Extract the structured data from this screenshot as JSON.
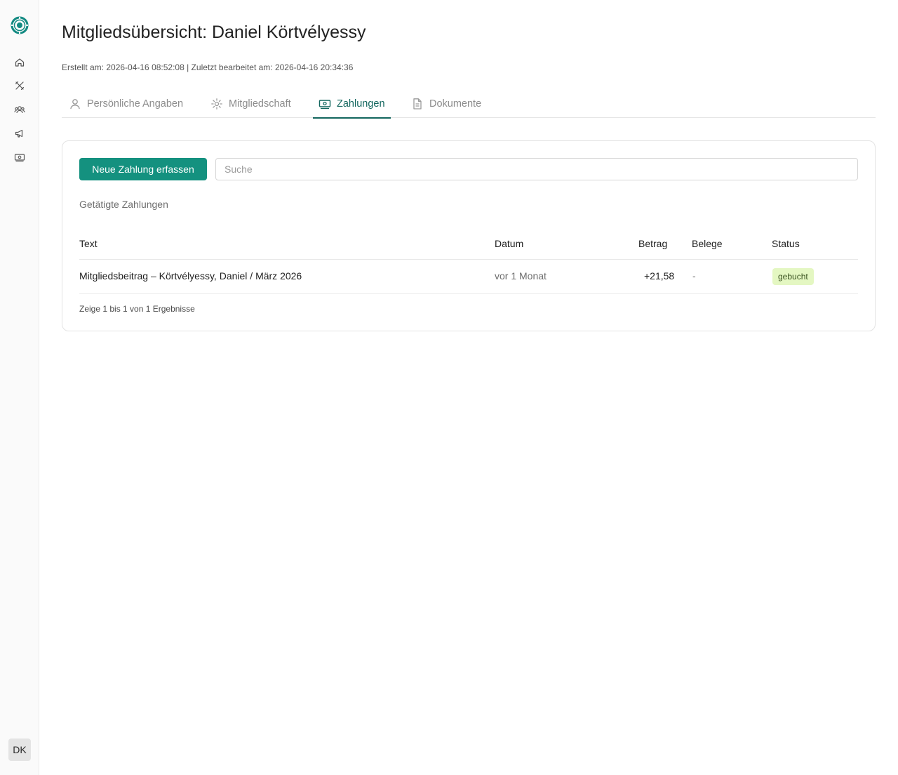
{
  "sidebar": {
    "logo": "club-logo",
    "items": [
      {
        "name": "home",
        "icon": "home-icon"
      },
      {
        "name": "tools",
        "icon": "tools-icon"
      },
      {
        "name": "members",
        "icon": "users-icon"
      },
      {
        "name": "announcements",
        "icon": "megaphone-icon"
      },
      {
        "name": "payments",
        "icon": "money-icon"
      }
    ],
    "user_initials": "DK"
  },
  "page": {
    "title": "Mitgliedsübersicht: Daniel Körtvélyessy",
    "meta": "Erstellt am: 2026-04-16 08:52:08 | Zuletzt bearbeitet am: 2026-04-16 20:34:36"
  },
  "tabs": [
    {
      "label": "Persönliche Angaben",
      "icon": "user-icon",
      "active": false
    },
    {
      "label": "Mitgliedschaft",
      "icon": "gear-icon",
      "active": false
    },
    {
      "label": "Zahlungen",
      "icon": "money-icon",
      "active": true
    },
    {
      "label": "Dokumente",
      "icon": "document-icon",
      "active": false
    }
  ],
  "payments": {
    "new_button": "Neue Zahlung erfassen",
    "search_placeholder": "Suche",
    "section_label": "Getätigte Zahlungen",
    "columns": [
      "Text",
      "Datum",
      "Betrag",
      "Belege",
      "Status"
    ],
    "rows": [
      {
        "text": "Mitgliedsbeitrag – Körtvélyessy, Daniel / März 2026",
        "date": "vor 1 Monat",
        "amount": "+21,58",
        "receipts": "-",
        "status": "gebucht"
      }
    ],
    "result_info": "Zeige 1 bis 1 von 1 Ergebnisse"
  },
  "colors": {
    "accent": "#14917f",
    "active_tab": "#12665e",
    "status_badge_bg": "#e4f7c2"
  }
}
